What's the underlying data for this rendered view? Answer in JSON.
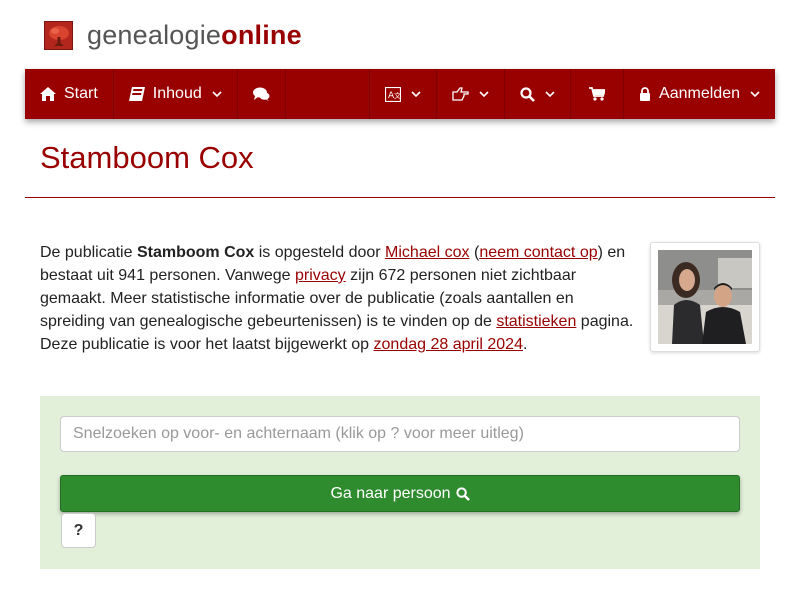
{
  "brand": {
    "name_part1": "genealogie",
    "name_part2": "online"
  },
  "nav": {
    "start_label": "Start",
    "inhoud_label": "Inhoud",
    "login_label": "Aanmelden"
  },
  "page": {
    "title": "Stamboom Cox"
  },
  "intro": {
    "t1": "De publicatie ",
    "pub_name": "Stamboom Cox",
    "t2": " is opgesteld door ",
    "author_link": "Michael cox",
    "t3": " (",
    "contact_link": "neem contact op",
    "t4": ") en bestaat uit 941 personen. Vanwege ",
    "privacy_link": "privacy",
    "t5": " zijn 672 personen niet zichtbaar gemaakt. Meer statistische informatie over de publicatie (zoals aantallen en spreiding van genealogische gebeurtenissen) is te vinden op de ",
    "stats_link": "statistieken",
    "t6": " pagina. Deze publicatie is voor het laatst bijgewerkt op ",
    "date_link": "zondag 28 april 2024",
    "t7": "."
  },
  "search": {
    "placeholder": "Snelzoeken op voor- en achternaam (klik op ? voor meer uitleg)",
    "go_label": "Ga naar persoon",
    "help_label": "?"
  },
  "colors": {
    "brand_red": "#990000",
    "panel_green": "#e2efd9",
    "button_green": "#2e8b2e"
  },
  "icons": [
    "tree-logo-icon",
    "home-icon",
    "book-icon",
    "comments-icon",
    "language-icon",
    "hand-pointer-icon",
    "search-icon",
    "cart-icon",
    "lock-icon",
    "chevron-down-icon"
  ]
}
